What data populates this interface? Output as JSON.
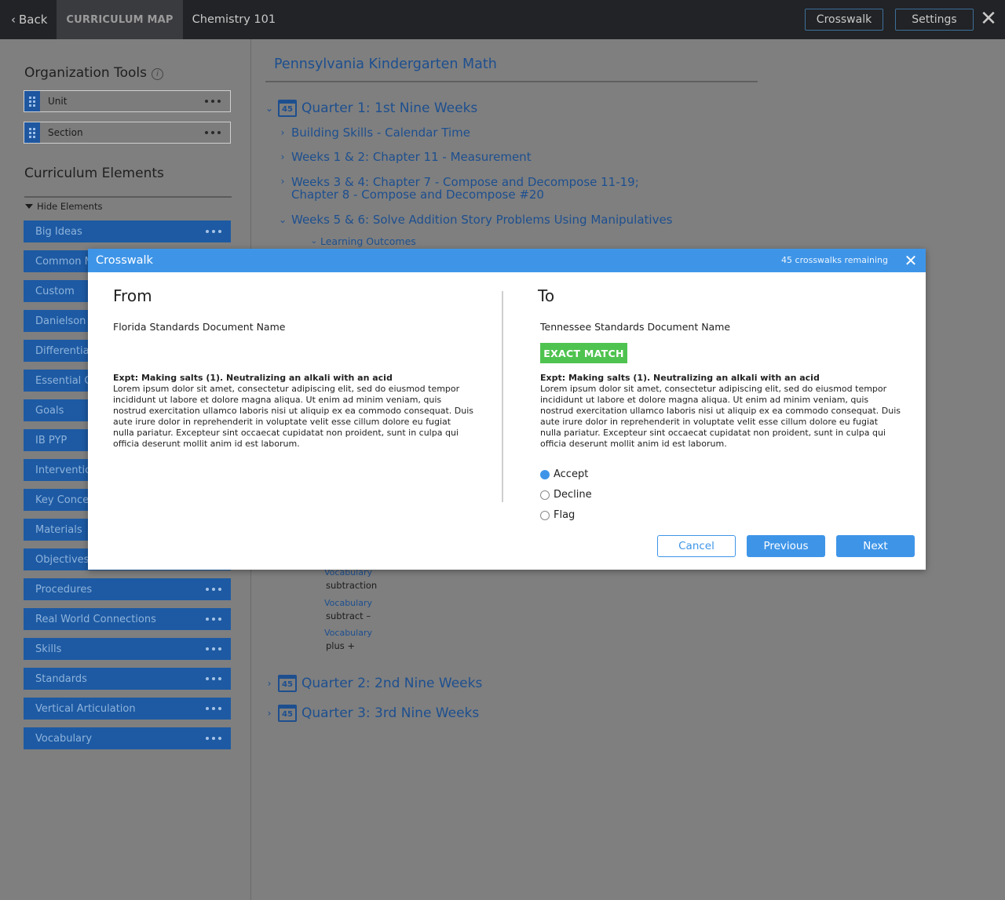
{
  "topbar": {
    "back_label": "Back",
    "section_label": "CURRICULUM MAP",
    "course_name": "Chemistry 101",
    "crosswalk_label": "Crosswalk",
    "settings_label": "Settings"
  },
  "left": {
    "org_tools_title": "Organization Tools",
    "org_tools": [
      {
        "label": "Unit"
      },
      {
        "label": "Section"
      }
    ],
    "elements_title": "Curriculum Elements",
    "hide_elements_label": "Hide Elements",
    "elements": [
      {
        "label": "Big Ideas"
      },
      {
        "label": "Common M"
      },
      {
        "label": "Custom"
      },
      {
        "label": "Danielson"
      },
      {
        "label": "Differentia"
      },
      {
        "label": "Essential Q"
      },
      {
        "label": "Goals"
      },
      {
        "label": "IB PYP"
      },
      {
        "label": "Interventio"
      },
      {
        "label": "Key Conce"
      },
      {
        "label": "Materials"
      },
      {
        "label": "Objectives"
      },
      {
        "label": "Procedures"
      },
      {
        "label": "Real World Connections"
      },
      {
        "label": "Skills"
      },
      {
        "label": "Standards"
      },
      {
        "label": "Vertical Articulation"
      },
      {
        "label": "Vocabulary"
      }
    ]
  },
  "main": {
    "doc_title": "Pennsylvania Kindergarten Math",
    "quarter1": {
      "label": "Quarter 1: 1st Nine Weeks",
      "days": "45"
    },
    "items": [
      {
        "label": "Building Skills - Calendar Time"
      },
      {
        "label": "Weeks 1 & 2: Chapter 11 - Measurement"
      },
      {
        "label": "Weeks 3 & 4: Chapter 7 - Compose and Decompose 11-19;",
        "label2": "Chapter 8 - Compose and Decompose #20"
      },
      {
        "label": "Weeks 5 & 6: Solve Addition Story Problems Using Manipulatives"
      }
    ],
    "learning_outcomes": "Learning Outcomes",
    "vocab": [
      {
        "label": "Vocabulary",
        "value": "subtraction"
      },
      {
        "label": "Vocabulary",
        "value": "subtract –"
      },
      {
        "label": "Vocabulary",
        "value": "plus +"
      }
    ],
    "quarter2": {
      "label": "Quarter 2: 2nd Nine Weeks",
      "days": "45"
    },
    "quarter3": {
      "label": "Quarter 3: 3rd Nine Weeks",
      "days": "45"
    }
  },
  "dialog": {
    "title": "Crosswalk",
    "remaining": "45 crosswalks remaining",
    "from_heading": "From",
    "to_heading": "To",
    "from_doc": "Florida Standards Document Name",
    "to_doc": "Tennessee Standards Document Name",
    "match_badge": "EXACT MATCH",
    "expt_title": "Expt: Making salts (1). Neutralizing an alkali with an acid",
    "expt_body": "Lorem ipsum dolor sit amet, consectetur adipiscing elit, sed do eiusmod tempor incididunt ut labore et dolore magna aliqua. Ut enim ad minim veniam, quis nostrud exercitation ullamco laboris nisi ut aliquip ex ea commodo consequat. Duis aute irure dolor in reprehenderit in voluptate velit esse cillum dolore eu fugiat nulla pariatur. Excepteur sint occaecat cupidatat non proident, sunt in culpa qui officia deserunt mollit anim id est laborum.",
    "options": [
      {
        "label": "Accept",
        "selected": true
      },
      {
        "label": "Decline",
        "selected": false
      },
      {
        "label": "Flag",
        "selected": false
      }
    ],
    "cancel_label": "Cancel",
    "previous_label": "Previous",
    "next_label": "Next"
  }
}
